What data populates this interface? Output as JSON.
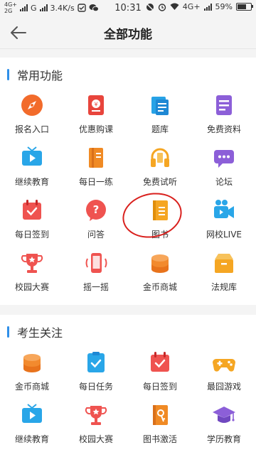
{
  "status": {
    "net1": "4G+",
    "net2": "2G",
    "carrier": "G",
    "speed": "3.4K/s",
    "time": "10:31",
    "net_right": "4G+",
    "battery": "59%"
  },
  "nav": {
    "title": "全部功能"
  },
  "sections": [
    {
      "title": "常用功能",
      "items": [
        {
          "label": "报名入口",
          "icon": "compass-icon"
        },
        {
          "label": "优惠购课",
          "icon": "coupon-icon"
        },
        {
          "label": "题库",
          "icon": "question-bank-icon"
        },
        {
          "label": "免费资料",
          "icon": "document-icon"
        },
        {
          "label": "继续教育",
          "icon": "tv-play-icon"
        },
        {
          "label": "每日一练",
          "icon": "book-icon"
        },
        {
          "label": "免费试听",
          "icon": "headphones-icon"
        },
        {
          "label": "论坛",
          "icon": "chat-bubble-icon"
        },
        {
          "label": "每日签到",
          "icon": "calendar-check-icon"
        },
        {
          "label": "问答",
          "icon": "question-bubble-icon"
        },
        {
          "label": "图书",
          "icon": "book-cover-icon"
        },
        {
          "label": "网校LIVE",
          "icon": "video-camera-icon"
        },
        {
          "label": "校园大赛",
          "icon": "trophy-icon"
        },
        {
          "label": "摇一摇",
          "icon": "phone-shake-icon"
        },
        {
          "label": "金币商城",
          "icon": "coin-stack-icon"
        },
        {
          "label": "法规库",
          "icon": "box-icon"
        }
      ]
    },
    {
      "title": "考生关注",
      "items": [
        {
          "label": "金币商城",
          "icon": "coin-stack-icon"
        },
        {
          "label": "每日任务",
          "icon": "task-check-icon"
        },
        {
          "label": "每日签到",
          "icon": "calendar-check-icon"
        },
        {
          "label": "最囧游戏",
          "icon": "gamepad-icon"
        },
        {
          "label": "继续教育",
          "icon": "tv-play-icon"
        },
        {
          "label": "校园大赛",
          "icon": "trophy-icon"
        },
        {
          "label": "图书激活",
          "icon": "book-key-icon"
        },
        {
          "label": "学历教育",
          "icon": "graduation-cap-icon"
        }
      ]
    }
  ],
  "colors": {
    "accent": "#2f8fe8",
    "annotation": "#d9201d"
  }
}
